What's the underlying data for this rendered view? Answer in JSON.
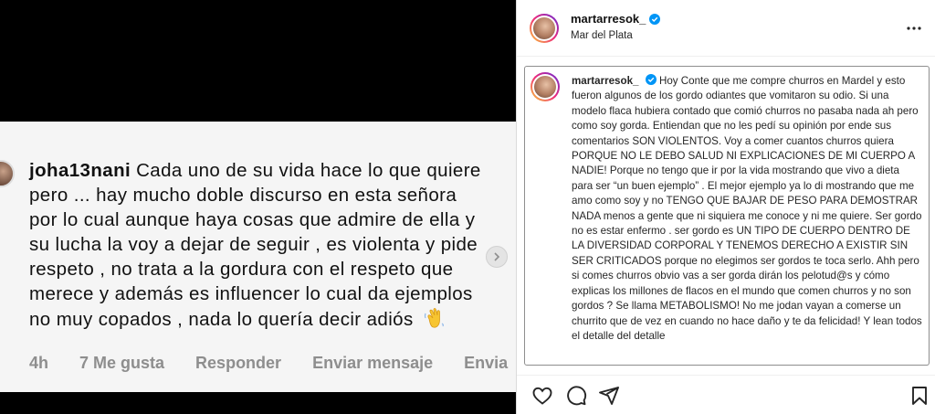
{
  "comment": {
    "username": "joha13nani",
    "text": "Cada uno de su vida hace lo que quiere pero ... hay mucho doble discurso en esta señora por lo cual aunque haya cosas que admire de ella y su lucha la voy a dejar de seguir , es violenta y pide respeto , no trata a la gordura con el respeto que merece y además es influencer lo cual da ejemplos no muy copados , nada lo quería decir adiós",
    "emoji": "waving-hand-icon",
    "time": "4h",
    "likes": "7 Me gusta",
    "reply": "Responder",
    "send": "Enviar mensaje",
    "cut": "Envia"
  },
  "post": {
    "username": "martarresok_",
    "location": "Mar del Plata",
    "caption_user": "martarresok_",
    "caption": "Hoy Conte que me compre churros en Mardel y esto fueron algunos de los gordo odiantes que vomitaron su odio. Si una modelo flaca hubiera contado que comió churros no pasaba nada ah pero como soy gorda. Entiendan que no les pedí su opinión por ende sus comentarios SON VIOLENTOS. Voy a comer cuantos churros quiera PORQUE NO LE DEBO SALUD NI EXPLICACIONES DE MI CUERPO A NADIE! Porque no tengo que ir por la vida mostrando que vivo a dieta para ser “un buen ejemplo” . El mejor ejemplo ya lo di mostrando que me amo como soy y no TENGO QUE BAJAR DE PESO PARA DEMOSTRAR NADA menos a gente que ni siquiera me conoce y ni me quiere. Ser gordo no es estar enfermo . ser gordo es UN TIPO DE CUERPO DENTRO DE LA DIVERSIDAD CORPORAL Y TENEMOS DERECHO A EXISTIR SIN SER CRITICADOS porque no elegimos ser gordos te toca serlo. Ahh pero si comes churros obvio vas a ser gorda dirán los pelotud@s y cómo explicas los millones de flacos en el mundo que comen churros y no son gordos ? Se llama METABOLISMO! No me jodan vayan a comerse un churrito que de vez en cuando no hace daño y te da felicidad! Y lean todos el detalle del detalle"
  },
  "colors": {
    "verified": "#0095f6",
    "muted": "#8e8e8e"
  }
}
